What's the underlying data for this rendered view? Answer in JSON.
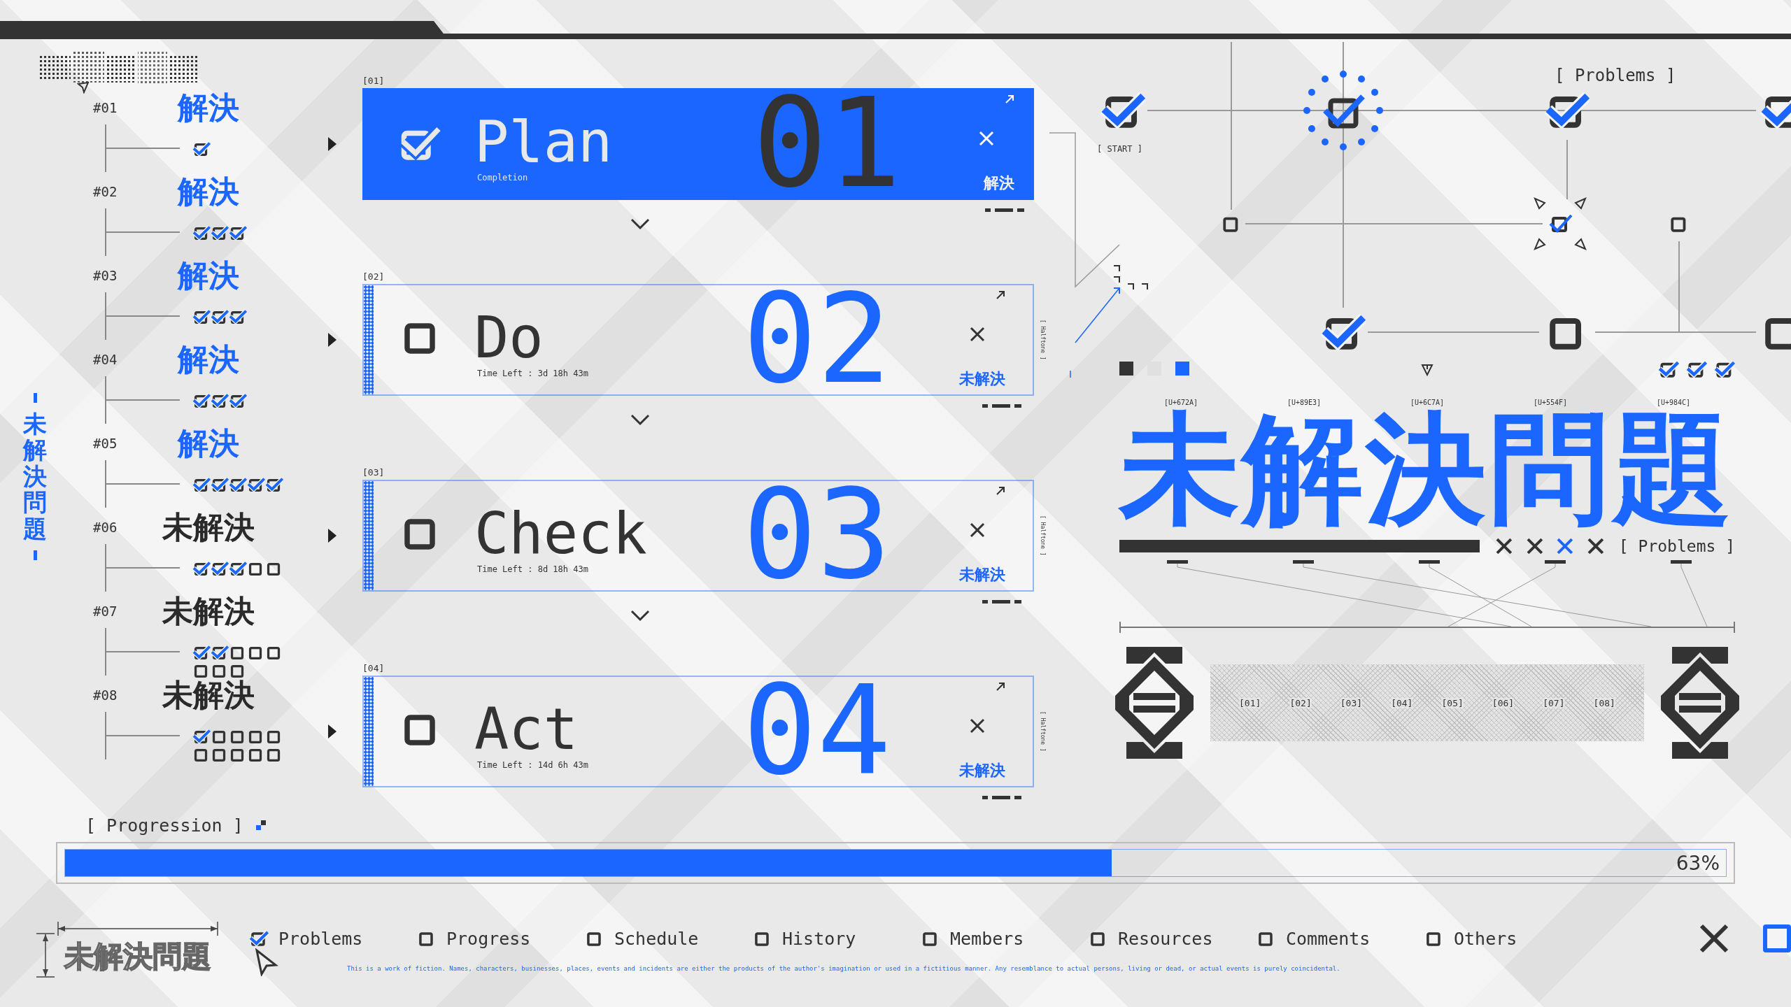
{
  "sidebar": {
    "vertical_title": "未解決問題",
    "items": [
      {
        "number": "#01",
        "status": "解決",
        "resolved": true,
        "checks": [
          true
        ]
      },
      {
        "number": "#02",
        "status": "解決",
        "resolved": true,
        "checks": [
          true,
          true,
          true
        ]
      },
      {
        "number": "#03",
        "status": "解決",
        "resolved": true,
        "checks": [
          true,
          true,
          true
        ]
      },
      {
        "number": "#04",
        "status": "解決",
        "resolved": true,
        "checks": [
          true,
          true,
          true
        ]
      },
      {
        "number": "#05",
        "status": "解決",
        "resolved": true,
        "checks": [
          true,
          true,
          true,
          true,
          true
        ]
      },
      {
        "number": "#06",
        "status": "未解決",
        "resolved": false,
        "checks": [
          true,
          true,
          true,
          false,
          false
        ]
      },
      {
        "number": "#07",
        "status": "未解決",
        "resolved": false,
        "checks": [
          true,
          true,
          false,
          false,
          false,
          false,
          false,
          false
        ]
      },
      {
        "number": "#08",
        "status": "未解決",
        "resolved": false,
        "checks": [
          true,
          false,
          false,
          false,
          false,
          false,
          false,
          false,
          false,
          false
        ]
      }
    ]
  },
  "cards": [
    {
      "index": "[01]",
      "title": "Plan",
      "subtitle": "Completion",
      "number": "01",
      "status": "解決",
      "checked": true
    },
    {
      "index": "[02]",
      "title": "Do",
      "subtitle": "Time Left : 3d 18h 43m",
      "number": "02",
      "status": "未解決",
      "checked": false,
      "side_note": "[ Halftone ]"
    },
    {
      "index": "[03]",
      "title": "Check",
      "subtitle": "Time Left : 8d 18h 43m",
      "number": "03",
      "status": "未解決",
      "checked": false,
      "side_note": "[ Halftone ]"
    },
    {
      "index": "[04]",
      "title": "Act",
      "subtitle": "Time Left : 14d 6h 43m",
      "number": "04",
      "status": "未解決",
      "checked": false,
      "side_note": "[ Halftone ]"
    }
  ],
  "diagram": {
    "title": "[ Problems ]",
    "start_label": "[ START ]",
    "nodes": [
      {
        "kind": "large",
        "checked": true
      },
      {
        "kind": "ring",
        "checked": true
      },
      {
        "kind": "large",
        "checked": true
      },
      {
        "kind": "large",
        "checked": true
      },
      {
        "kind": "small",
        "checked": false
      },
      {
        "kind": "target",
        "checked": true
      },
      {
        "kind": "small",
        "checked": false
      },
      {
        "kind": "large",
        "checked": true
      },
      {
        "kind": "large",
        "checked": false
      },
      {
        "kind": "large",
        "checked": false
      }
    ],
    "swatches": [
      {
        "color": "#333333"
      },
      {
        "color": "#e0e0e0"
      },
      {
        "color": "#1a66ff"
      }
    ],
    "mini_checks": [
      true,
      true,
      true
    ]
  },
  "headline": {
    "codes": [
      "[U+672A]",
      "[U+89E3]",
      "[U+6C7A]",
      "[U+554F]",
      "[U+984C]"
    ],
    "title": "未解決問題",
    "x_marks": [
      {
        "color": "#333333"
      },
      {
        "color": "#333333"
      },
      {
        "color": "#1a66ff"
      },
      {
        "color": "#333333"
      }
    ],
    "label": "[ Problems ]",
    "slots": [
      "[01]",
      "[02]",
      "[03]",
      "[04]",
      "[05]",
      "[06]",
      "[07]",
      "[08]"
    ]
  },
  "progress": {
    "label": "[ Progression ]",
    "level": 0.63,
    "reading": "63%"
  },
  "footer": {
    "outline_title": "未解決問題",
    "filters": [
      {
        "label": "Problems",
        "checked": true
      },
      {
        "label": "Progress",
        "checked": false
      },
      {
        "label": "Schedule",
        "checked": false
      },
      {
        "label": "History",
        "checked": false
      },
      {
        "label": "Members",
        "checked": false
      },
      {
        "label": "Resources",
        "checked": false
      },
      {
        "label": "Comments",
        "checked": false
      },
      {
        "label": "Others",
        "checked": false
      }
    ],
    "disclaimer": "This is a work of fiction. Names, characters, businesses, places, events and incidents are either the products of the author's imagination or used in a fictitious manner. Any resemblance to actual persons, living or dead, or actual events is purely coincidental."
  }
}
